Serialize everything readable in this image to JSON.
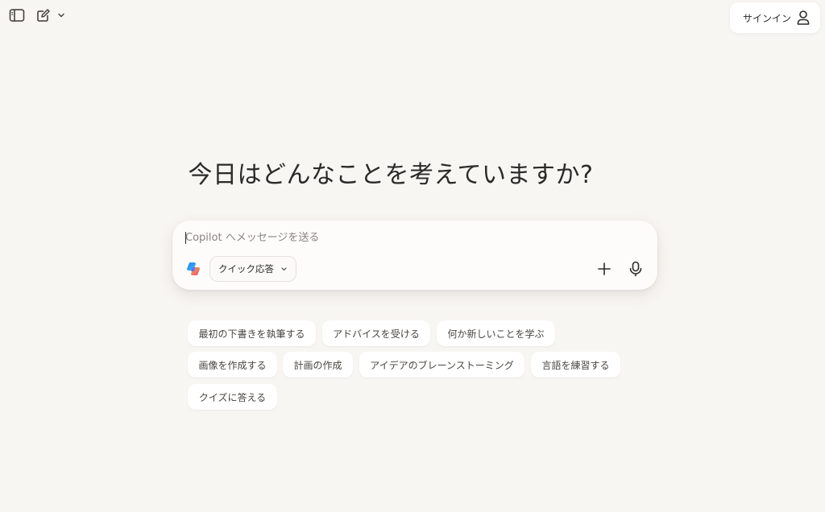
{
  "header": {
    "icons": [
      "sidebar-toggle-icon",
      "new-chat-icon",
      "chevron-down-icon"
    ],
    "signin_label": "サインイン",
    "signin_icon": "user-icon"
  },
  "main": {
    "headline": "今日はどんなことを考えていますか?"
  },
  "composer": {
    "placeholder": "Copilot へメッセージを送る",
    "value": "",
    "mode_label": "クイック応答",
    "icons": [
      "copilot-logo",
      "plus-icon",
      "microphone-icon"
    ]
  },
  "suggestions": [
    "最初の下書きを執筆する",
    "アドバイスを受ける",
    "何か新しいことを学ぶ",
    "画像を作成する",
    "計画の作成",
    "アイデアのブレーンストーミング",
    "言語を練習する",
    "クイズに答える"
  ],
  "colors": {
    "background": "#f8f6f3",
    "surface": "#ffffff",
    "text": "#2c2a28",
    "muted": "#8a8580"
  }
}
